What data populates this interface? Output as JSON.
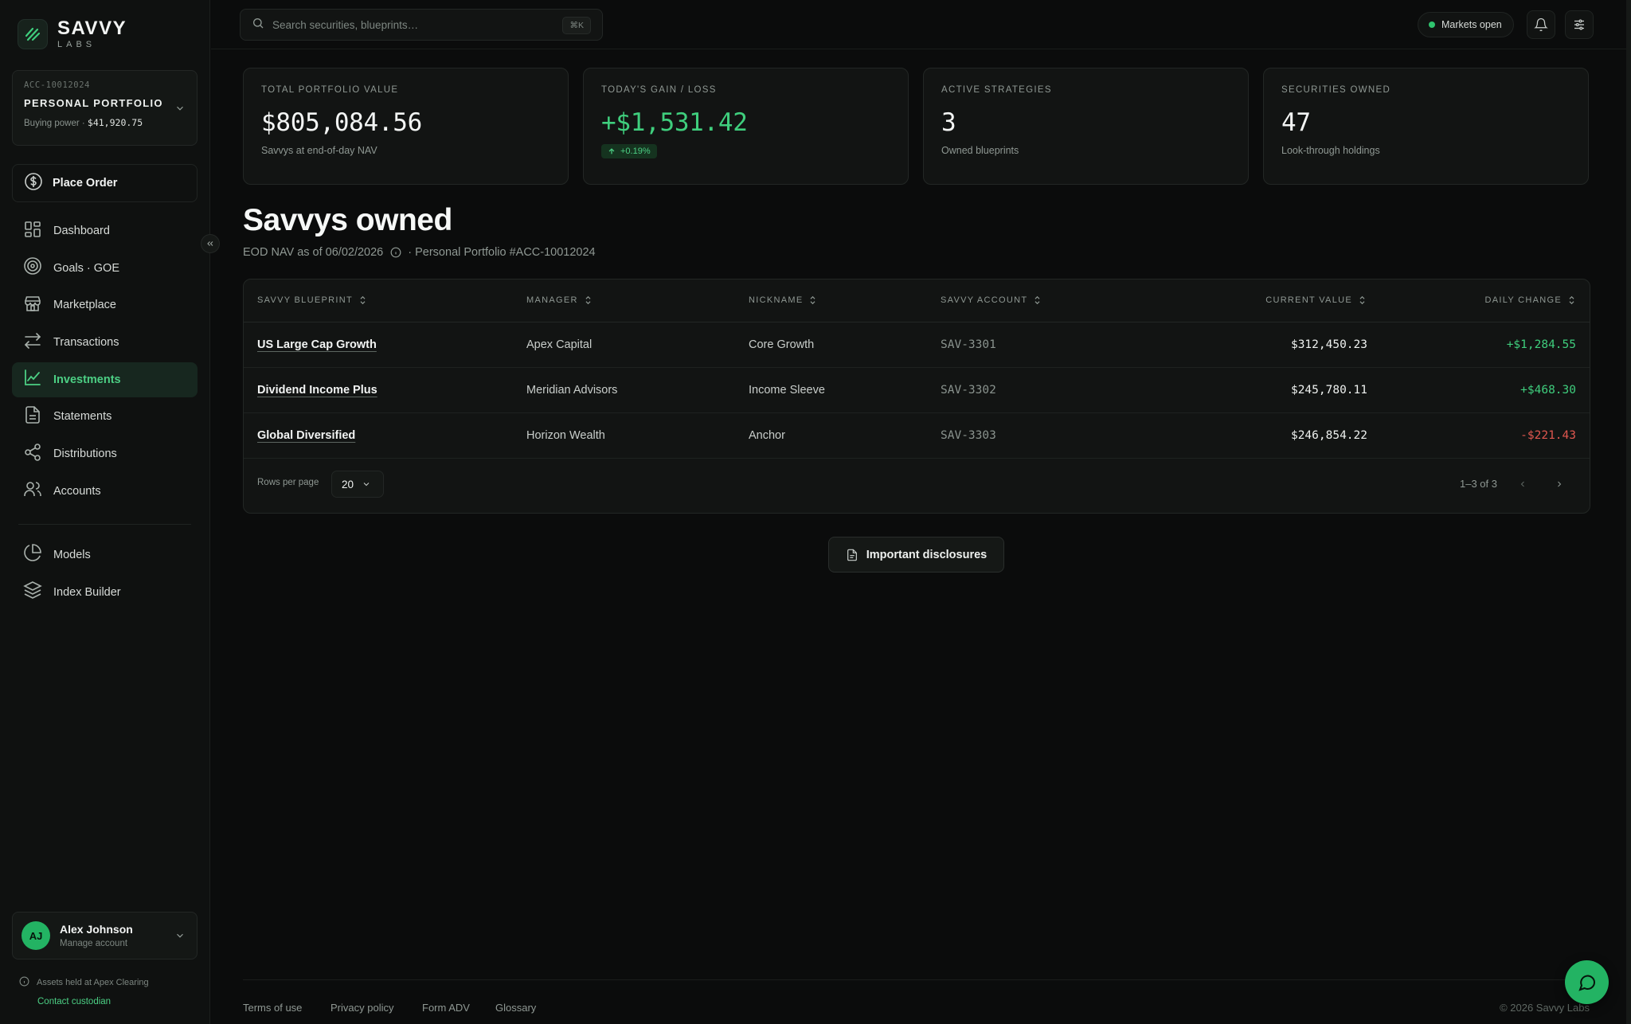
{
  "brand": {
    "name": "SAVVY",
    "sub": "LABS",
    "accent": "#23b363"
  },
  "account": {
    "id": "ACC-10012024",
    "name": "PERSONAL PORTFOLIO",
    "buying_power_label": "Buying power · ",
    "buying_power_value": "$41,920.75"
  },
  "place_order_label": "Place Order",
  "nav": [
    {
      "label": "Dashboard",
      "icon": "dashboard-icon"
    },
    {
      "label": "Goals · GOE",
      "icon": "target-icon"
    },
    {
      "label": "Marketplace",
      "icon": "store-icon"
    },
    {
      "label": "Transactions",
      "icon": "arrows-icon"
    },
    {
      "label": "Investments",
      "icon": "chart-line-icon",
      "active": true
    },
    {
      "label": "Statements",
      "icon": "document-icon"
    },
    {
      "label": "Distributions",
      "icon": "share-icon"
    },
    {
      "label": "Accounts",
      "icon": "users-icon"
    }
  ],
  "nav_secondary": [
    {
      "label": "Models",
      "icon": "pie-icon"
    },
    {
      "label": "Index Builder",
      "icon": "layers-icon"
    }
  ],
  "user": {
    "initials": "AJ",
    "name": "Alex Johnson",
    "sub": "Manage account"
  },
  "custody": {
    "text": "Assets held at Apex Clearing",
    "link": "Contact custodian"
  },
  "search": {
    "placeholder": "Search securities, blueprints…",
    "shortcut": "⌘K"
  },
  "markets_status": "Markets open",
  "stats": [
    {
      "label": "TOTAL PORTFOLIO VALUE",
      "value": "$805,084.56",
      "sub": "Savvys at end-of-day NAV"
    },
    {
      "label": "TODAY'S GAIN / LOSS",
      "value": "+$1,531.42",
      "badge": "+0.19%"
    },
    {
      "label": "ACTIVE STRATEGIES",
      "value": "3",
      "sub": "Owned blueprints"
    },
    {
      "label": "SECURITIES OWNED",
      "value": "47",
      "sub": "Look-through holdings"
    }
  ],
  "page": {
    "title": "Savvys owned",
    "meta_nav": "EOD NAV as of 06/02/2026",
    "meta_portfolio": "· Personal Portfolio #ACC-10012024"
  },
  "table": {
    "columns": [
      "SAVVY BLUEPRINT",
      "MANAGER",
      "NICKNAME",
      "SAVVY ACCOUNT",
      "CURRENT VALUE",
      "DAILY CHANGE"
    ],
    "rows": [
      {
        "blueprint": "US Large Cap Growth",
        "manager": "Apex Capital",
        "nickname": "Core Growth",
        "account": "SAV-3301",
        "value": "$312,450.23",
        "change": "+$1,284.55",
        "direction": "up"
      },
      {
        "blueprint": "Dividend Income Plus",
        "manager": "Meridian Advisors",
        "nickname": "Income Sleeve",
        "account": "SAV-3302",
        "value": "$245,780.11",
        "change": "+$468.30",
        "direction": "up"
      },
      {
        "blueprint": "Global Diversified",
        "manager": "Horizon Wealth",
        "nickname": "Anchor",
        "account": "SAV-3303",
        "value": "$246,854.22",
        "change": "-$221.43",
        "direction": "down"
      }
    ],
    "rows_per_page_label": "Rows per page",
    "rows_per_page_value": "20",
    "range": "1–3 of 3"
  },
  "disclosures_label": "Important disclosures",
  "footer": {
    "links": [
      "Terms of use",
      "Privacy policy",
      "Form ADV",
      "Glossary"
    ],
    "copyright": "© 2026 Savvy Labs"
  }
}
